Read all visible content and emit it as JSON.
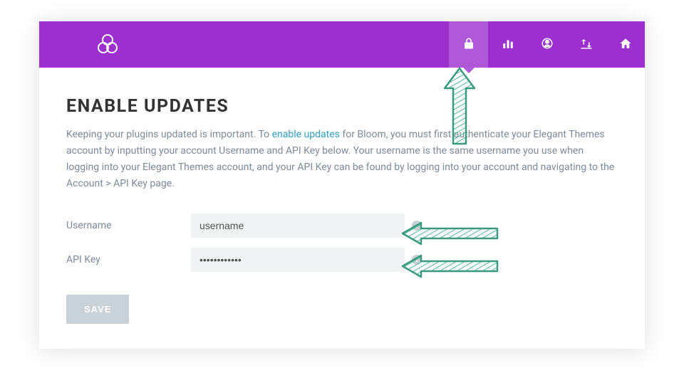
{
  "header": {
    "nav_active_index": 0
  },
  "page": {
    "title": "ENABLE UPDATES",
    "desc_1": "Keeping your plugins updated is important. To ",
    "link_text": "enable updates",
    "desc_2": " for Bloom, you must first authenticate your Elegant Themes account by inputting your account Username and API Key below. Your username is the same username you use when logging into your Elegant Themes account, and your API Key can be found by logging into your account and navigating to the Account > API Key page."
  },
  "form": {
    "username_label": "Username",
    "username_value": "username",
    "apikey_label": "API Key",
    "apikey_value": "••••••••••••"
  },
  "buttons": {
    "save": "SAVE"
  },
  "colors": {
    "header": "#9b30cf",
    "arrow": "#4fb99a"
  }
}
